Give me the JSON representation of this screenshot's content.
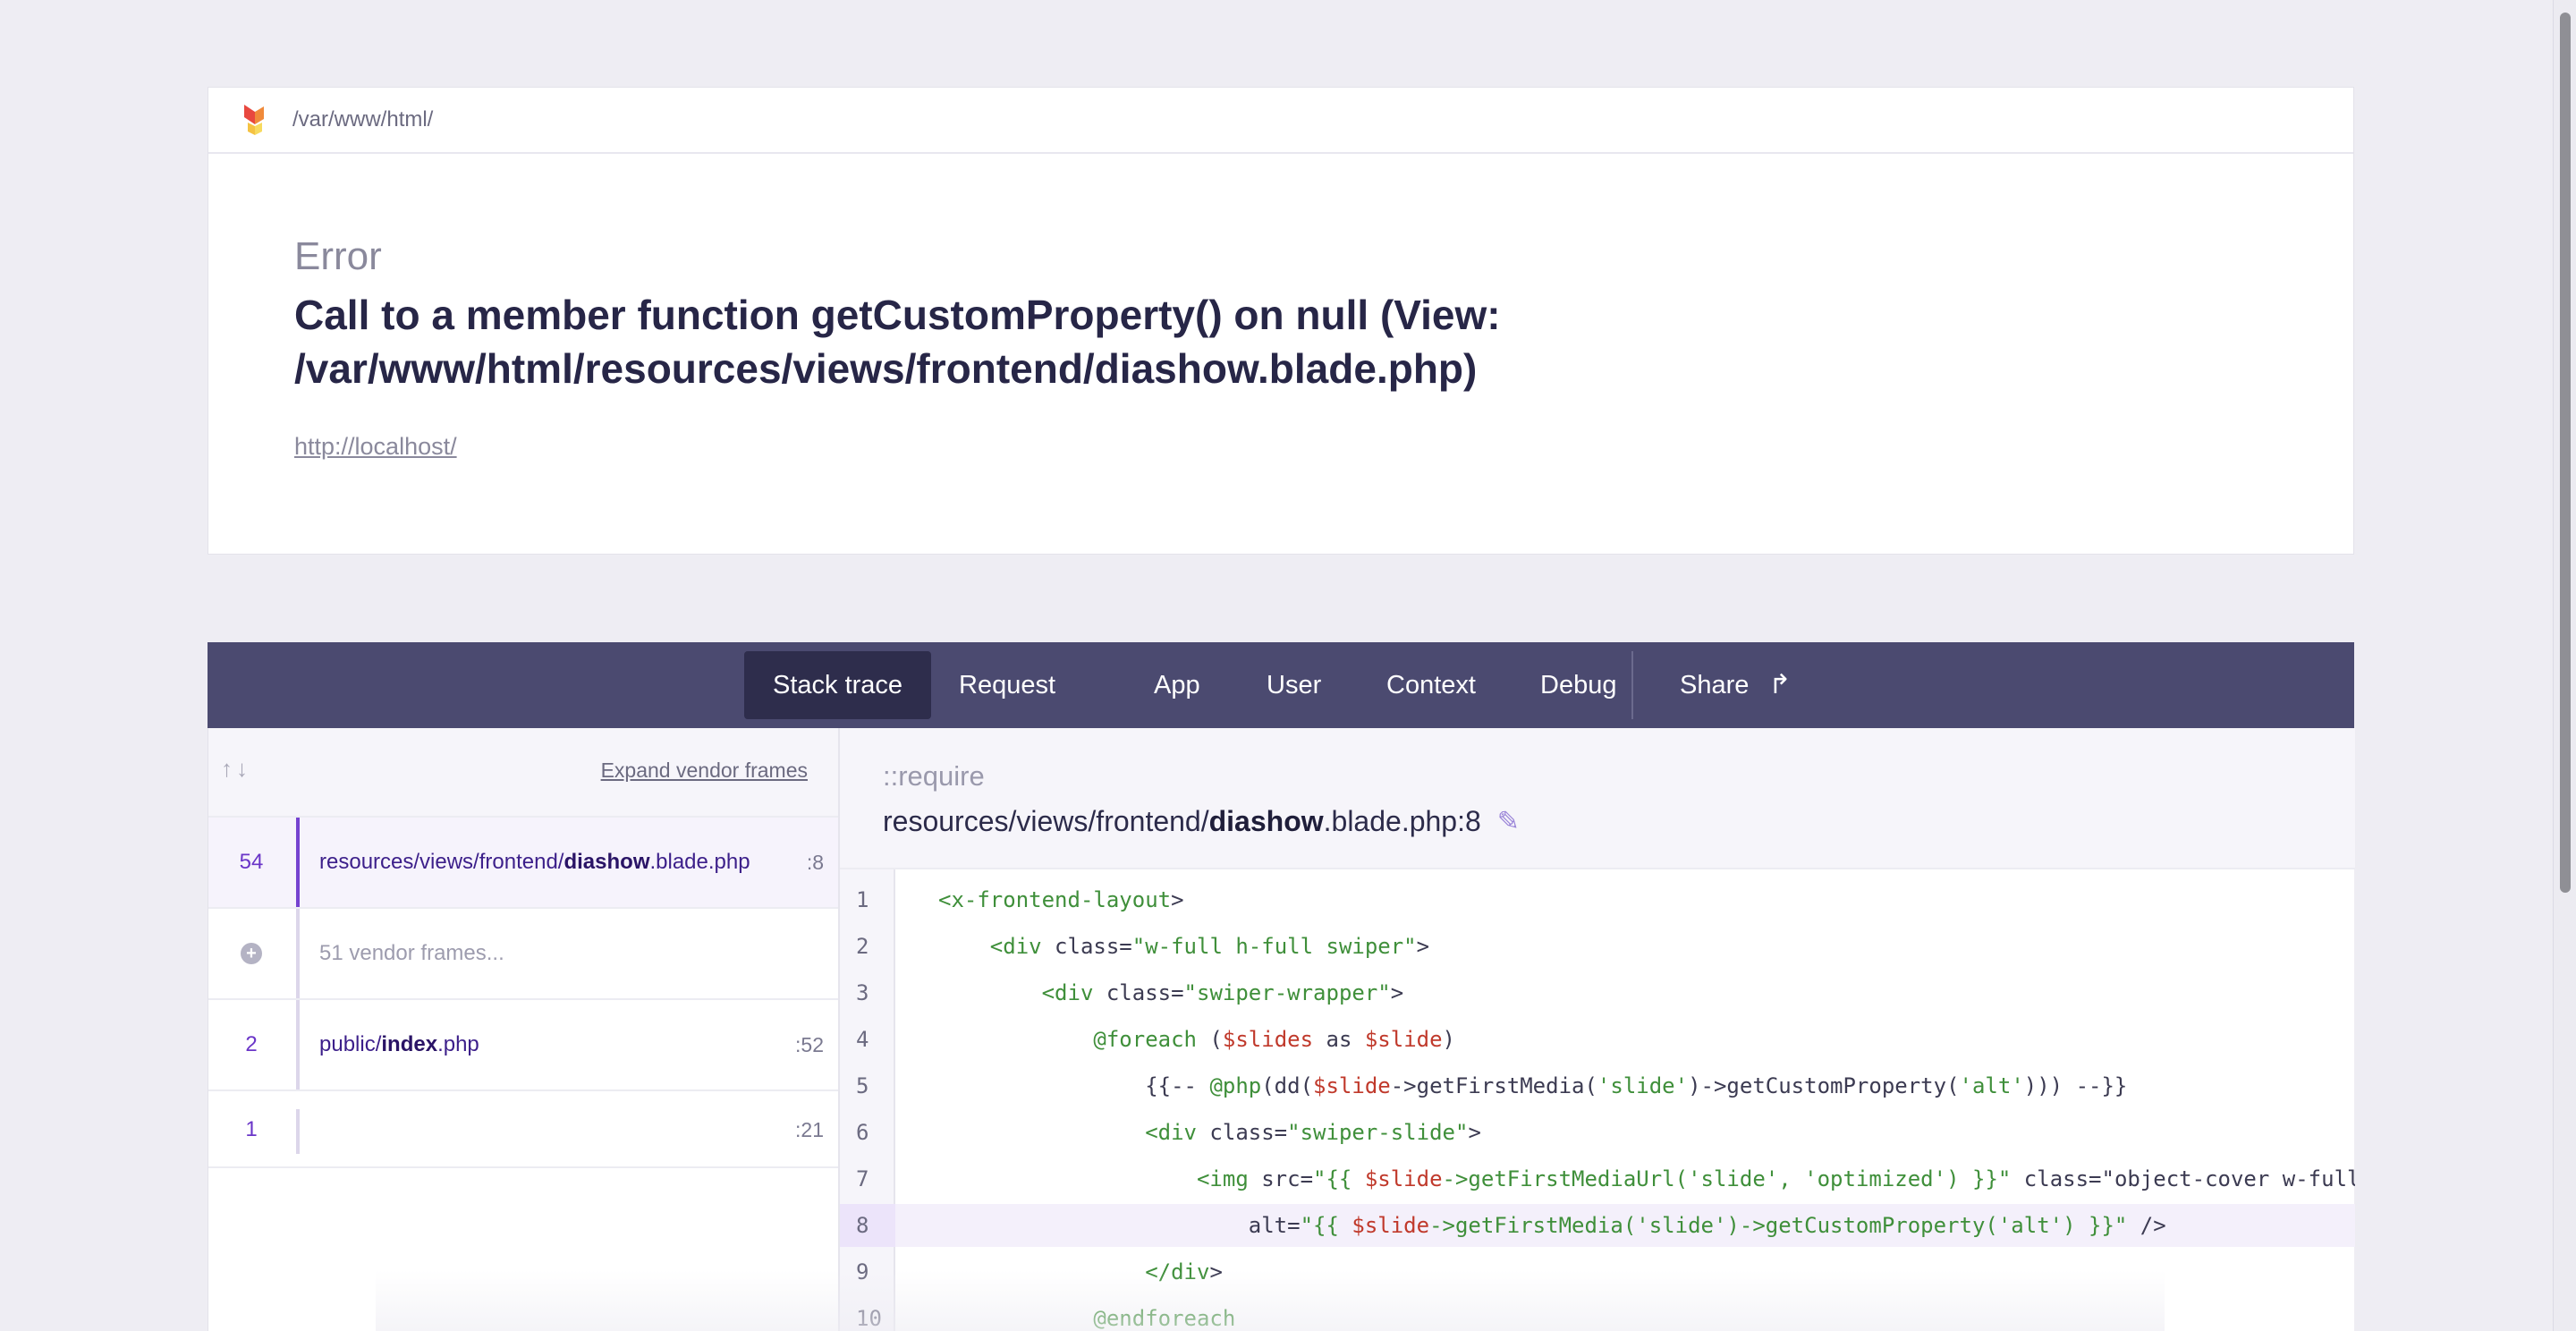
{
  "header": {
    "path": "/var/www/html/",
    "exception_type": "Error",
    "exception_message": "Call to a member function getCustomProperty() on null (View: /var/www/html/resources/views/frontend/diashow.blade.php)",
    "url": "http://localhost/"
  },
  "tabs": [
    {
      "label": "Stack trace"
    },
    {
      "label": "Request"
    },
    {
      "label": "App"
    },
    {
      "label": "User"
    },
    {
      "label": "Context"
    },
    {
      "label": "Debug"
    },
    {
      "label": "Share"
    }
  ],
  "frames_panel": {
    "expand_label": "Expand vendor frames",
    "frames": [
      {
        "number": "54",
        "file_prefix": "resources/views/frontend/",
        "file_bold": "diashow",
        "file_suffix": ".blade.php",
        "line": ":8"
      },
      {
        "label": "51 vendor frames..."
      },
      {
        "number": "2",
        "file_prefix": "public/",
        "file_bold": "index",
        "file_suffix": ".php",
        "line": ":52"
      },
      {
        "number": "1",
        "line": ":21"
      }
    ]
  },
  "code_panel": {
    "method": "::require",
    "file_prefix": "resources/views/frontend/",
    "file_bold": "diashow",
    "file_suffix": ".blade.php:8",
    "lines": [
      {
        "n": "1",
        "code": "<x-frontend-layout>"
      },
      {
        "n": "2",
        "code": "    <div class=\"w-full h-full swiper\">"
      },
      {
        "n": "3",
        "code": "        <div class=\"swiper-wrapper\">"
      },
      {
        "n": "4",
        "code": "            @foreach ($slides as $slide)"
      },
      {
        "n": "5",
        "code": "                {{-- @php(dd($slide->getFirstMedia('slide')->getCustomProperty('alt'))) --}}"
      },
      {
        "n": "6",
        "code": "                <div class=\"swiper-slide\">"
      },
      {
        "n": "7",
        "code": "                    <img src=\"{{ $slide->getFirstMediaUrl('slide', 'optimized') }}\" class=\"object-cover w-full"
      },
      {
        "n": "8",
        "code": "                        alt=\"{{ $slide->getFirstMedia('slide')->getCustomProperty('alt') }}\" />"
      },
      {
        "n": "9",
        "code": "                </div>"
      },
      {
        "n": "10",
        "code": "            @endforeach"
      }
    ]
  },
  "colors": {
    "tabbar": "#4b4a70",
    "active_tab": "#2e2d4c",
    "accent": "#7542d0",
    "highlight_line": "#f4f0fb"
  }
}
